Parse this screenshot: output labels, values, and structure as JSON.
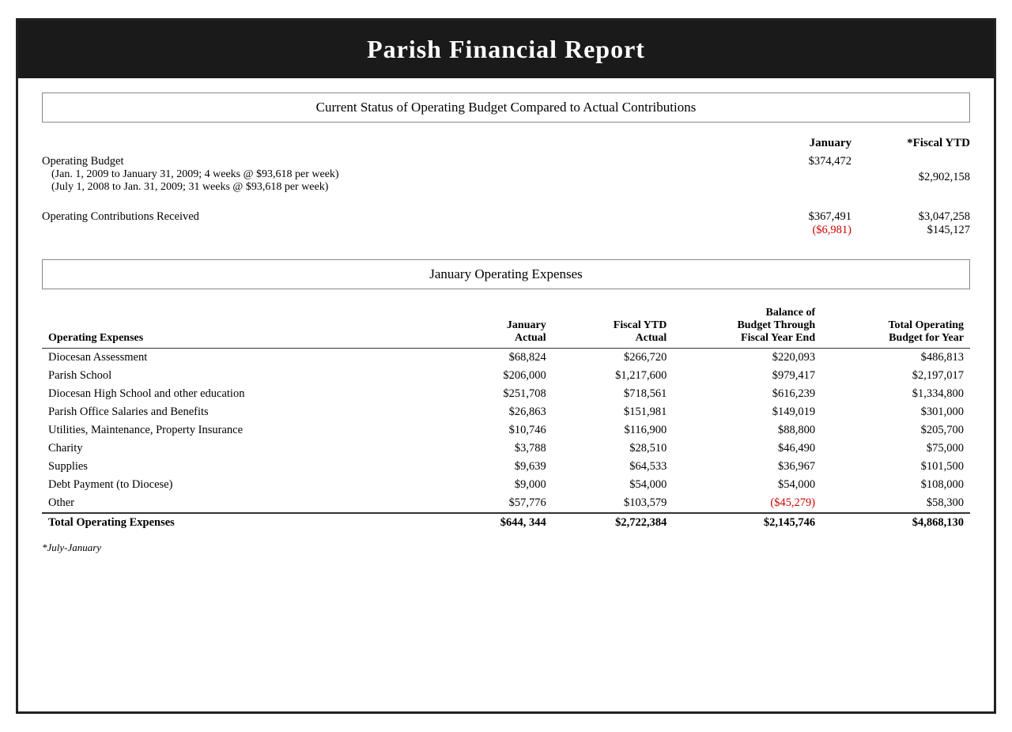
{
  "header": {
    "title": "Parish Financial Report"
  },
  "operating_budget_section": {
    "section_title": "Current Status of Operating Budget Compared to Actual Contributions",
    "col_january_label": "January",
    "col_ytd_label": "*Fiscal YTD",
    "rows": [
      {
        "main_label": "Operating Budget",
        "sub_labels": [
          "(Jan. 1, 2009 to January 31, 2009; 4 weeks @ $93,618 per week)",
          "(July 1, 2008 to Jan. 31, 2009; 31 weeks @ $93,618 per week)"
        ],
        "january": "$374,472",
        "january_ytd": "",
        "ytd": "$2,902,158"
      }
    ],
    "contributions_label": "Operating Contributions Received",
    "contributions_january": "$367,491",
    "contributions_diff": "($6,981)",
    "contributions_ytd": "$3,047,258",
    "contributions_ytd_diff": "$145,127"
  },
  "expenses_section": {
    "section_title": "January Operating Expenses",
    "col_headers": {
      "label": "Operating Expenses",
      "january_actual": "January\nActual",
      "fiscal_ytd_actual": "Fiscal YTD\nActual",
      "balance_budget": "Balance of\nBudget Through\nFiscal Year End",
      "total_budget": "Total Operating\nBudget for Year"
    },
    "rows": [
      {
        "label": "Diocesan Assessment",
        "january_actual": "$68,824",
        "fiscal_ytd": "$266,720",
        "balance": "$220,093",
        "total": "$486,813"
      },
      {
        "label": "Parish School",
        "january_actual": "$206,000",
        "fiscal_ytd": "$1,217,600",
        "balance": "$979,417",
        "total": "$2,197,017"
      },
      {
        "label": "Diocesan High School and other education",
        "january_actual": "$251,708",
        "fiscal_ytd": "$718,561",
        "balance": "$616,239",
        "total": "$1,334,800"
      },
      {
        "label": "Parish Office Salaries and Benefits",
        "january_actual": "$26,863",
        "fiscal_ytd": "$151,981",
        "balance": "$149,019",
        "total": "$301,000"
      },
      {
        "label": "Utilities, Maintenance, Property Insurance",
        "january_actual": "$10,746",
        "fiscal_ytd": "$116,900",
        "balance": "$88,800",
        "total": "$205,700"
      },
      {
        "label": "Charity",
        "january_actual": "$3,788",
        "fiscal_ytd": "$28,510",
        "balance": "$46,490",
        "total": "$75,000"
      },
      {
        "label": "Supplies",
        "january_actual": "$9,639",
        "fiscal_ytd": "$64,533",
        "balance": "$36,967",
        "total": "$101,500"
      },
      {
        "label": "Debt Payment (to Diocese)",
        "january_actual": "$9,000",
        "fiscal_ytd": "$54,000",
        "balance": "$54,000",
        "total": "$108,000"
      },
      {
        "label": "Other",
        "january_actual": "$57,776",
        "fiscal_ytd": "$103,579",
        "balance": "($45,279)",
        "balance_negative": true,
        "total": "$58,300"
      }
    ],
    "total_row": {
      "label": "Total Operating Expenses",
      "january_actual": "$644, 344",
      "fiscal_ytd": "$2,722,384",
      "balance": "$2,145,746",
      "total": "$4,868,130"
    },
    "footnote": "*July-January"
  }
}
